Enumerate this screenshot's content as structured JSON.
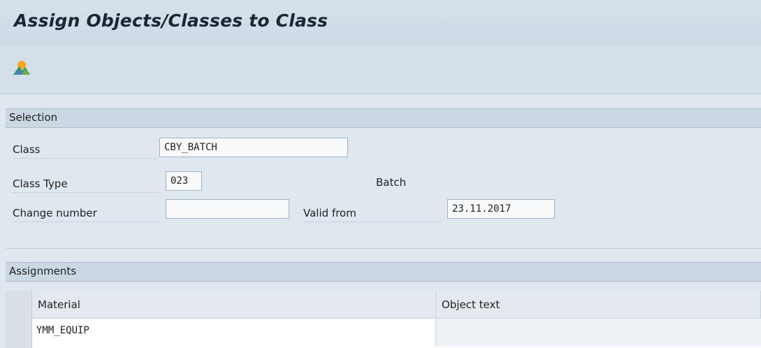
{
  "window": {
    "title": "Assign Objects/Classes to Class"
  },
  "toolbar": {
    "icons": [
      {
        "name": "landscape-icon"
      }
    ]
  },
  "selection": {
    "header": "Selection",
    "class_label": "Class",
    "class_value": "CBY_BATCH",
    "class_type_label": "Class Type",
    "class_type_value": "023",
    "class_type_text": "Batch",
    "change_number_label": "Change number",
    "change_number_value": "",
    "valid_from_label": "Valid from",
    "valid_from_value": "23.11.2017"
  },
  "assignments": {
    "header": "Assignments",
    "columns": [
      "Material",
      "Object text"
    ],
    "rows": [
      {
        "material": "YMM_EQUIP",
        "object_text": ""
      }
    ]
  }
}
